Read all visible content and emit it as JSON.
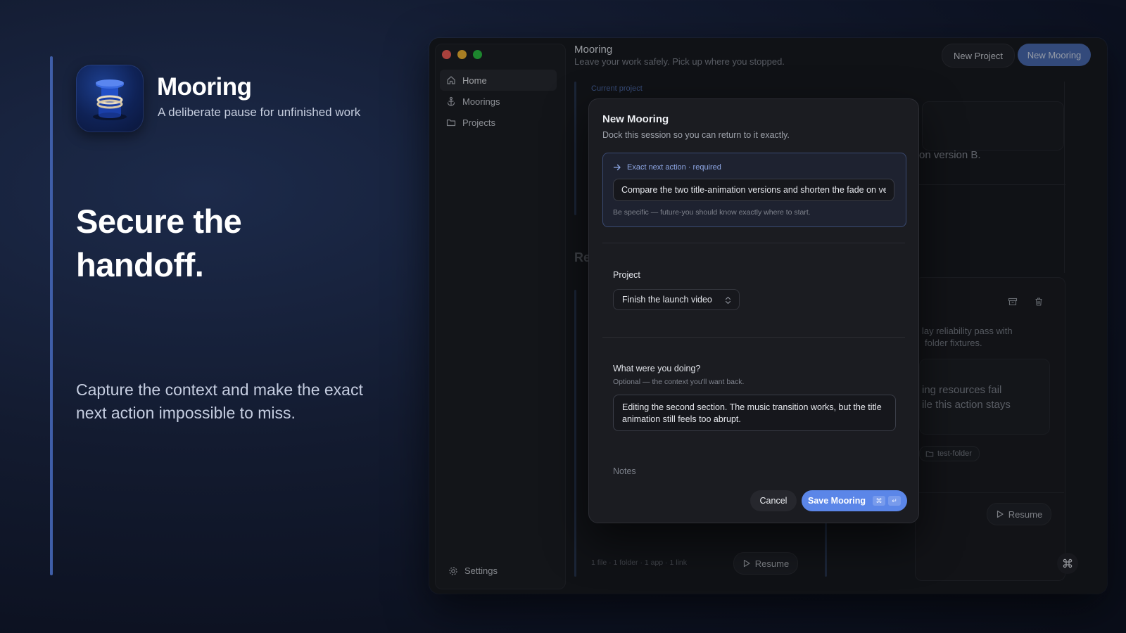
{
  "hero": {
    "app_name": "Mooring",
    "tagline": "A deliberate pause for unfinished work",
    "headline_line1": "Secure the",
    "headline_line2": "handoff.",
    "description": "Capture the context and make the exact next action impossible to miss."
  },
  "sidebar": {
    "items": [
      {
        "label": "Home",
        "icon": "home-icon"
      },
      {
        "label": "Moorings",
        "icon": "anchor-icon"
      },
      {
        "label": "Projects",
        "icon": "folder-icon"
      }
    ],
    "settings_label": "Settings"
  },
  "header": {
    "title": "Mooring",
    "subtitle": "Leave your work safely. Pick up where you stopped.",
    "new_project_label": "New Project",
    "new_mooring_label": "New Mooring"
  },
  "background": {
    "current_project_label": "Current project",
    "section_partial": "Re",
    "card_partial_1": "on version B.",
    "card_partial_2a": "lay reliability pass with",
    "card_partial_2b": "folder fixtures.",
    "card_partial_3a": "ing resources fail",
    "card_partial_3b": "ile this action stays",
    "tag_label": "test-folder",
    "meta": "1 file · 1 folder · 1 app · 1 link",
    "resume_label": "Resume",
    "resume_label_right": "Resume"
  },
  "modal": {
    "title": "New Mooring",
    "subtitle": "Dock this session so you can return to it exactly.",
    "next_action_label": "Exact next action · required",
    "next_action_value": "Compare the two title-animation versions and shorten the fade on version B.",
    "next_action_hint": "Be specific — future-you should know exactly where to start.",
    "project_label": "Project",
    "project_value": "Finish the launch video",
    "doing_label": "What were you doing?",
    "doing_hint": "Optional — the context you'll want back.",
    "doing_value": "Editing the second section. The music transition works, but the title animation still feels too abrupt.",
    "notes_label": "Notes",
    "cancel_label": "Cancel",
    "save_label": "Save Mooring",
    "shortcut_cmd": "⌘",
    "shortcut_enter": "↵"
  },
  "colors": {
    "accent": "#5b86e8",
    "brand_blue": "#1d3f8f",
    "traffic_red": "#ff5f57",
    "traffic_yellow": "#febc2e",
    "traffic_green": "#28c840"
  }
}
